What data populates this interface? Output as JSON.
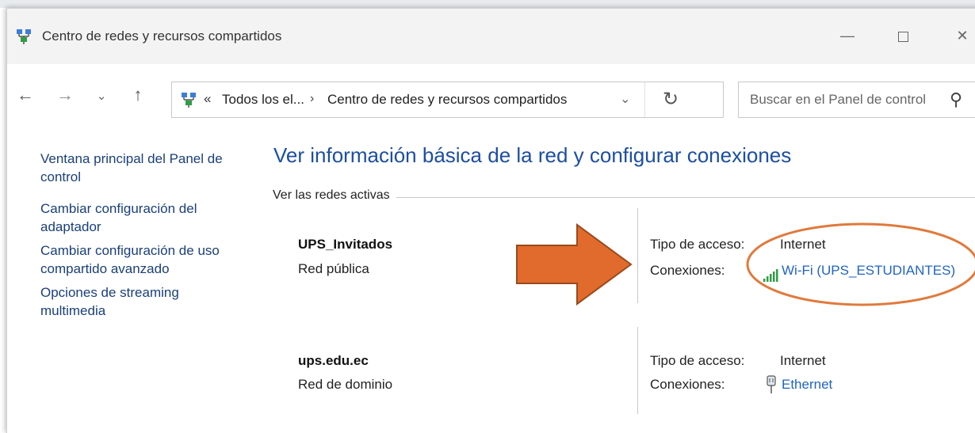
{
  "window": {
    "title": "Centro de redes y recursos compartidos",
    "minimize_glyph": "—",
    "close_glyph": "✕"
  },
  "nav": {
    "back_glyph": "←",
    "forward_glyph": "→",
    "recent_glyph": "⌄",
    "up_glyph": "↑",
    "address": {
      "chevron": "«",
      "crumb1": "Todos los el...",
      "separator": "›",
      "crumb2": "Centro de redes y recursos compartidos",
      "dropdown_glyph": "⌄",
      "refresh_glyph": "↻"
    },
    "search_placeholder": "Buscar en el Panel de control",
    "search_icon_glyph": "⚲"
  },
  "sidebar": {
    "items": [
      {
        "label": "Ventana principal del Panel de control"
      },
      {
        "label": "Cambiar configuración del adaptador"
      },
      {
        "label": "Cambiar configuración de uso compartido avanzado"
      },
      {
        "label": "Opciones de streaming multimedia"
      }
    ]
  },
  "main": {
    "title": "Ver información básica de la red y configurar conexiones",
    "section_label": "Ver las redes activas",
    "networks": [
      {
        "name": "UPS_Invitados",
        "type": "Red pública",
        "access_label": "Tipo de acceso:",
        "access_value": "Internet",
        "connections_label": "Conexiones:",
        "connection_value": "Wi-Fi (UPS_ESTUDIANTES)",
        "connection_icon": "wifi-signal-icon"
      },
      {
        "name": "ups.edu.ec",
        "type": "Red de dominio",
        "access_label": "Tipo de acceso:",
        "access_value": "Internet",
        "connections_label": "Conexiones:",
        "connection_value": "Ethernet",
        "connection_icon": "ethernet-icon"
      }
    ]
  },
  "annotation": {
    "arrow_color": "#e06b2c",
    "ellipse_color": "#e07a3c"
  }
}
